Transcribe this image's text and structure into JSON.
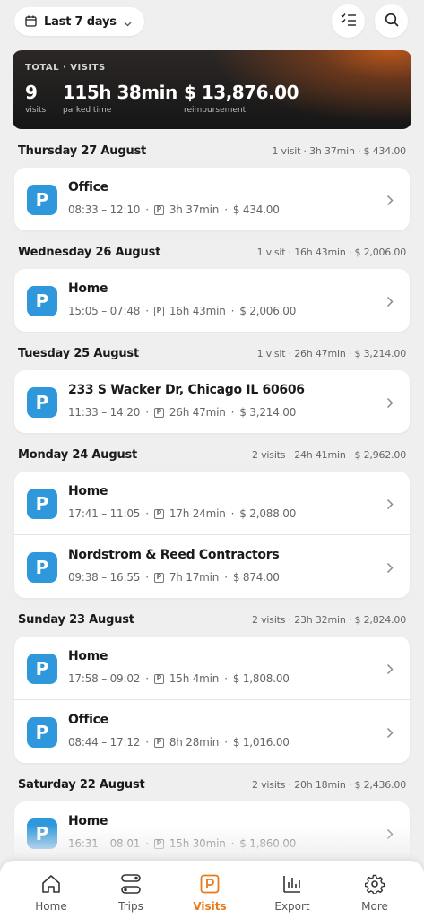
{
  "topbar": {
    "range_label": "Last 7 days"
  },
  "summary": {
    "caption": "TOTAL · VISITS",
    "visits_value": "9",
    "visits_label": "visits",
    "time_value": "115h 38min",
    "time_label": "parked time",
    "amount_value": "$ 13,876.00",
    "amount_label": "reimbursement"
  },
  "days": [
    {
      "date": "Thursday 27 August",
      "summary": "1 visit · 3h 37min · $ 434.00",
      "visits": [
        {
          "title": "Office",
          "time": "08:33 – 12:10",
          "duration": "3h 37min",
          "amount": "$ 434.00"
        }
      ]
    },
    {
      "date": "Wednesday 26 August",
      "summary": "1 visit · 16h 43min · $ 2,006.00",
      "visits": [
        {
          "title": "Home",
          "time": "15:05 – 07:48",
          "duration": "16h 43min",
          "amount": "$ 2,006.00"
        }
      ]
    },
    {
      "date": "Tuesday 25 August",
      "summary": "1 visit · 26h 47min · $ 3,214.00",
      "visits": [
        {
          "title": "233 S Wacker Dr, Chicago IL 60606",
          "time": "11:33 – 14:20",
          "duration": "26h 47min",
          "amount": "$ 3,214.00"
        }
      ]
    },
    {
      "date": "Monday 24 August",
      "summary": "2 visits · 24h 41min · $ 2,962.00",
      "visits": [
        {
          "title": "Home",
          "time": "17:41 – 11:05",
          "duration": "17h 24min",
          "amount": "$ 2,088.00"
        },
        {
          "title": "Nordstrom & Reed Contractors",
          "time": "09:38 – 16:55",
          "duration": "7h 17min",
          "amount": "$ 874.00"
        }
      ]
    },
    {
      "date": "Sunday 23 August",
      "summary": "2 visits · 23h 32min · $ 2,824.00",
      "visits": [
        {
          "title": "Home",
          "time": "17:58 – 09:02",
          "duration": "15h 4min",
          "amount": "$ 1,808.00"
        },
        {
          "title": "Office",
          "time": "08:44 – 17:12",
          "duration": "8h 28min",
          "amount": "$ 1,016.00"
        }
      ]
    },
    {
      "date": "Saturday 22 August",
      "summary": "2 visits · 20h 18min · $ 2,436.00",
      "visits": [
        {
          "title": "Home",
          "time": "16:31 – 08:01",
          "duration": "15h 30min",
          "amount": "$ 1,860.00"
        }
      ]
    }
  ],
  "badge_letter": "P",
  "meta_sep": "·",
  "tabs": [
    {
      "label": "Home",
      "icon": "home-icon"
    },
    {
      "label": "Trips",
      "icon": "route-icon"
    },
    {
      "label": "Visits",
      "icon": "parking-icon",
      "active": true
    },
    {
      "label": "Export",
      "icon": "bar-chart-icon"
    },
    {
      "label": "More",
      "icon": "gear-icon"
    }
  ],
  "colors": {
    "accent": "#e97a18",
    "badge": "#2f97dc",
    "background": "#efefef"
  }
}
